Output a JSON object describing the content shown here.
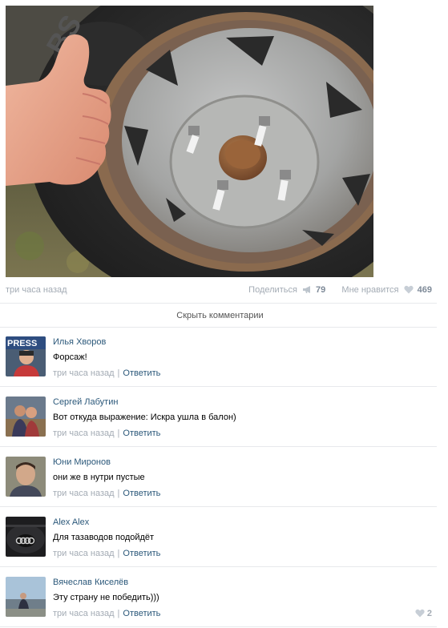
{
  "post": {
    "time": "три часа назад",
    "share_label": "Поделиться",
    "share_count": "79",
    "like_label": "Мне нравится",
    "like_count": "469"
  },
  "comments_toggle": "Скрыть комментарии",
  "comments": [
    {
      "author": "Илья Хворов",
      "text": "Форсаж!",
      "time": "три часа назад",
      "reply": "Ответить",
      "avatar_badge": "PRESS"
    },
    {
      "author": "Сергей Лабутин",
      "text": "Вот откуда выражение: Искра ушла в балон)",
      "time": "три часа назад",
      "reply": "Ответить"
    },
    {
      "author": "Юни Миронов",
      "text": "они же в нутри пустые",
      "time": "три часа назад",
      "reply": "Ответить"
    },
    {
      "author": "Alex Alex",
      "text": "Для тазаводов подойдёт",
      "time": "три часа назад",
      "reply": "Ответить"
    },
    {
      "author": "Вячеслав Киселёв",
      "text": "Эту страну не победить)))",
      "time": "три часа назад",
      "reply": "Ответить",
      "likes": "2"
    }
  ],
  "icons": {
    "share": "megaphone-icon",
    "like": "heart-icon"
  },
  "colors": {
    "link": "#2b587a",
    "muted": "#a3abb4",
    "divider": "#e7e9ec"
  }
}
